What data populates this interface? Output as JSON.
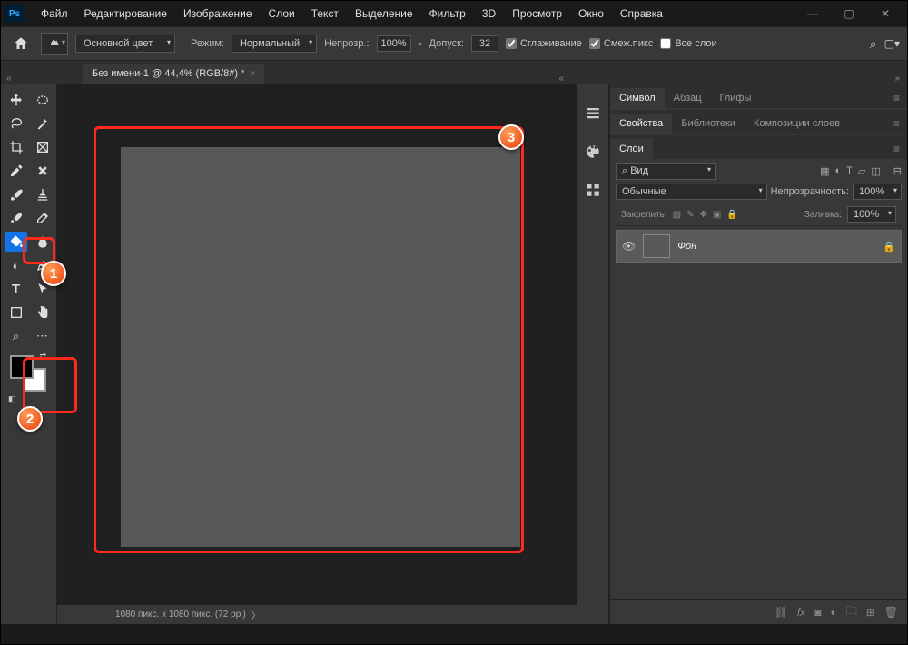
{
  "app": {
    "name": "Ps"
  },
  "menu": [
    "Файл",
    "Редактирование",
    "Изображение",
    "Слои",
    "Текст",
    "Выделение",
    "Фильтр",
    "3D",
    "Просмотр",
    "Окно",
    "Справка"
  ],
  "options": {
    "fill_source_label": "Основной цвет",
    "mode_label": "Режим:",
    "mode_value": "Нормальный",
    "opacity_label": "Непрозр.:",
    "opacity_value": "100%",
    "tolerance_label": "Допуск:",
    "tolerance_value": "32",
    "antialias_label": "Сглаживание",
    "contiguous_label": "Смеж.пикс",
    "all_layers_label": "Все слои"
  },
  "doc": {
    "tab_title": "Без имени-1 @ 44,4% (RGB/8#) *",
    "status": "1080 пикс. x 1080 пикс. (72 ppi)"
  },
  "panels": {
    "symbol_tab": "Символ",
    "paragraph_tab": "Абзац",
    "glyphs_tab": "Глифы",
    "properties_tab": "Свойства",
    "libraries_tab": "Библиотеки",
    "comps_tab": "Композиции слоев",
    "layers_tab": "Слои",
    "layers": {
      "filter_placeholder": "Вид",
      "blend_mode": "Обычные",
      "opacity_label": "Непрозрачность:",
      "opacity_value": "100%",
      "lock_label": "Закрепить:",
      "fill_label": "Заливка:",
      "fill_value": "100%",
      "layer_name": "Фон"
    }
  },
  "badges": {
    "b1": "1",
    "b2": "2",
    "b3": "3"
  }
}
